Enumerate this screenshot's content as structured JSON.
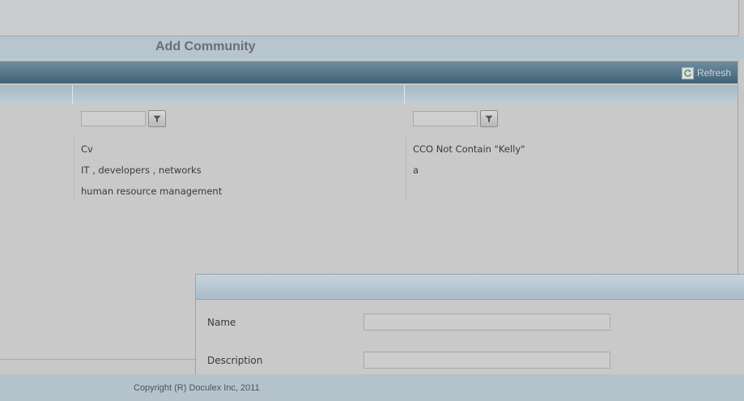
{
  "page": {
    "title": "Add Community"
  },
  "toolbar": {
    "refresh_label": "Refresh"
  },
  "filters": {
    "col2_placeholder": "",
    "col3_placeholder": ""
  },
  "rows": [
    {
      "col2": "Cv",
      "col3": "CCO Not Contain \"Kelly\""
    },
    {
      "col2": "IT , developers , networks",
      "col3": "a"
    },
    {
      "col2": "human resource management",
      "col3": ""
    }
  ],
  "dialog": {
    "name_label": "Name",
    "description_label": "Description",
    "name_value": "",
    "description_value": ""
  },
  "footer": {
    "copyright": "Copyright (R) Doculex Inc, 2011"
  },
  "colors": {
    "toolbar_dark": "#3e6276",
    "header_blue": "#b7c5cf",
    "footer_blue": "#b4c3cc"
  }
}
